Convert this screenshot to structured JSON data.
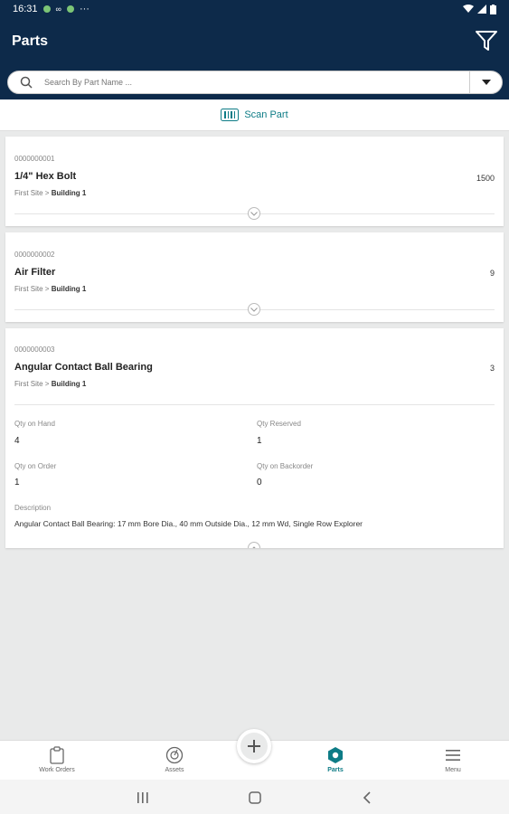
{
  "status_bar": {
    "time": "16:31",
    "dots": "···"
  },
  "header": {
    "title": "Parts"
  },
  "search": {
    "placeholder": "Search By Part Name ..."
  },
  "scan": {
    "label": "Scan Part"
  },
  "parts": [
    {
      "id": "0000000001",
      "name": "1/4\" Hex Bolt",
      "qty": "1500",
      "site": "First Site",
      "separator": ">",
      "building": "Building 1"
    },
    {
      "id": "0000000002",
      "name": "Air Filter",
      "qty": "9",
      "site": "First Site",
      "separator": ">",
      "building": "Building 1"
    },
    {
      "id": "0000000003",
      "name": "Angular Contact Ball Bearing",
      "qty": "3",
      "site": "First Site",
      "separator": ">",
      "building": "Building 1",
      "details": {
        "qty_on_hand_label": "Qty on Hand",
        "qty_on_hand": "4",
        "qty_reserved_label": "Qty Reserved",
        "qty_reserved": "1",
        "qty_on_order_label": "Qty on Order",
        "qty_on_order": "1",
        "qty_on_backorder_label": "Qty on Backorder",
        "qty_on_backorder": "0",
        "description_label": "Description",
        "description": "Angular Contact Ball Bearing: 17 mm Bore Dia., 40 mm Outside Dia., 12 mm Wd, Single Row Explorer"
      }
    }
  ],
  "bottom_nav": [
    {
      "label": "Work Orders",
      "icon": "clipboard-icon"
    },
    {
      "label": "Assets",
      "icon": "gauge-icon"
    },
    {
      "label": "Parts",
      "icon": "hex-nut-icon"
    },
    {
      "label": "Menu",
      "icon": "hamburger-icon"
    }
  ],
  "colors": {
    "header": "#0d2a4a",
    "accent": "#0e7c86",
    "background": "#e9eaea"
  }
}
